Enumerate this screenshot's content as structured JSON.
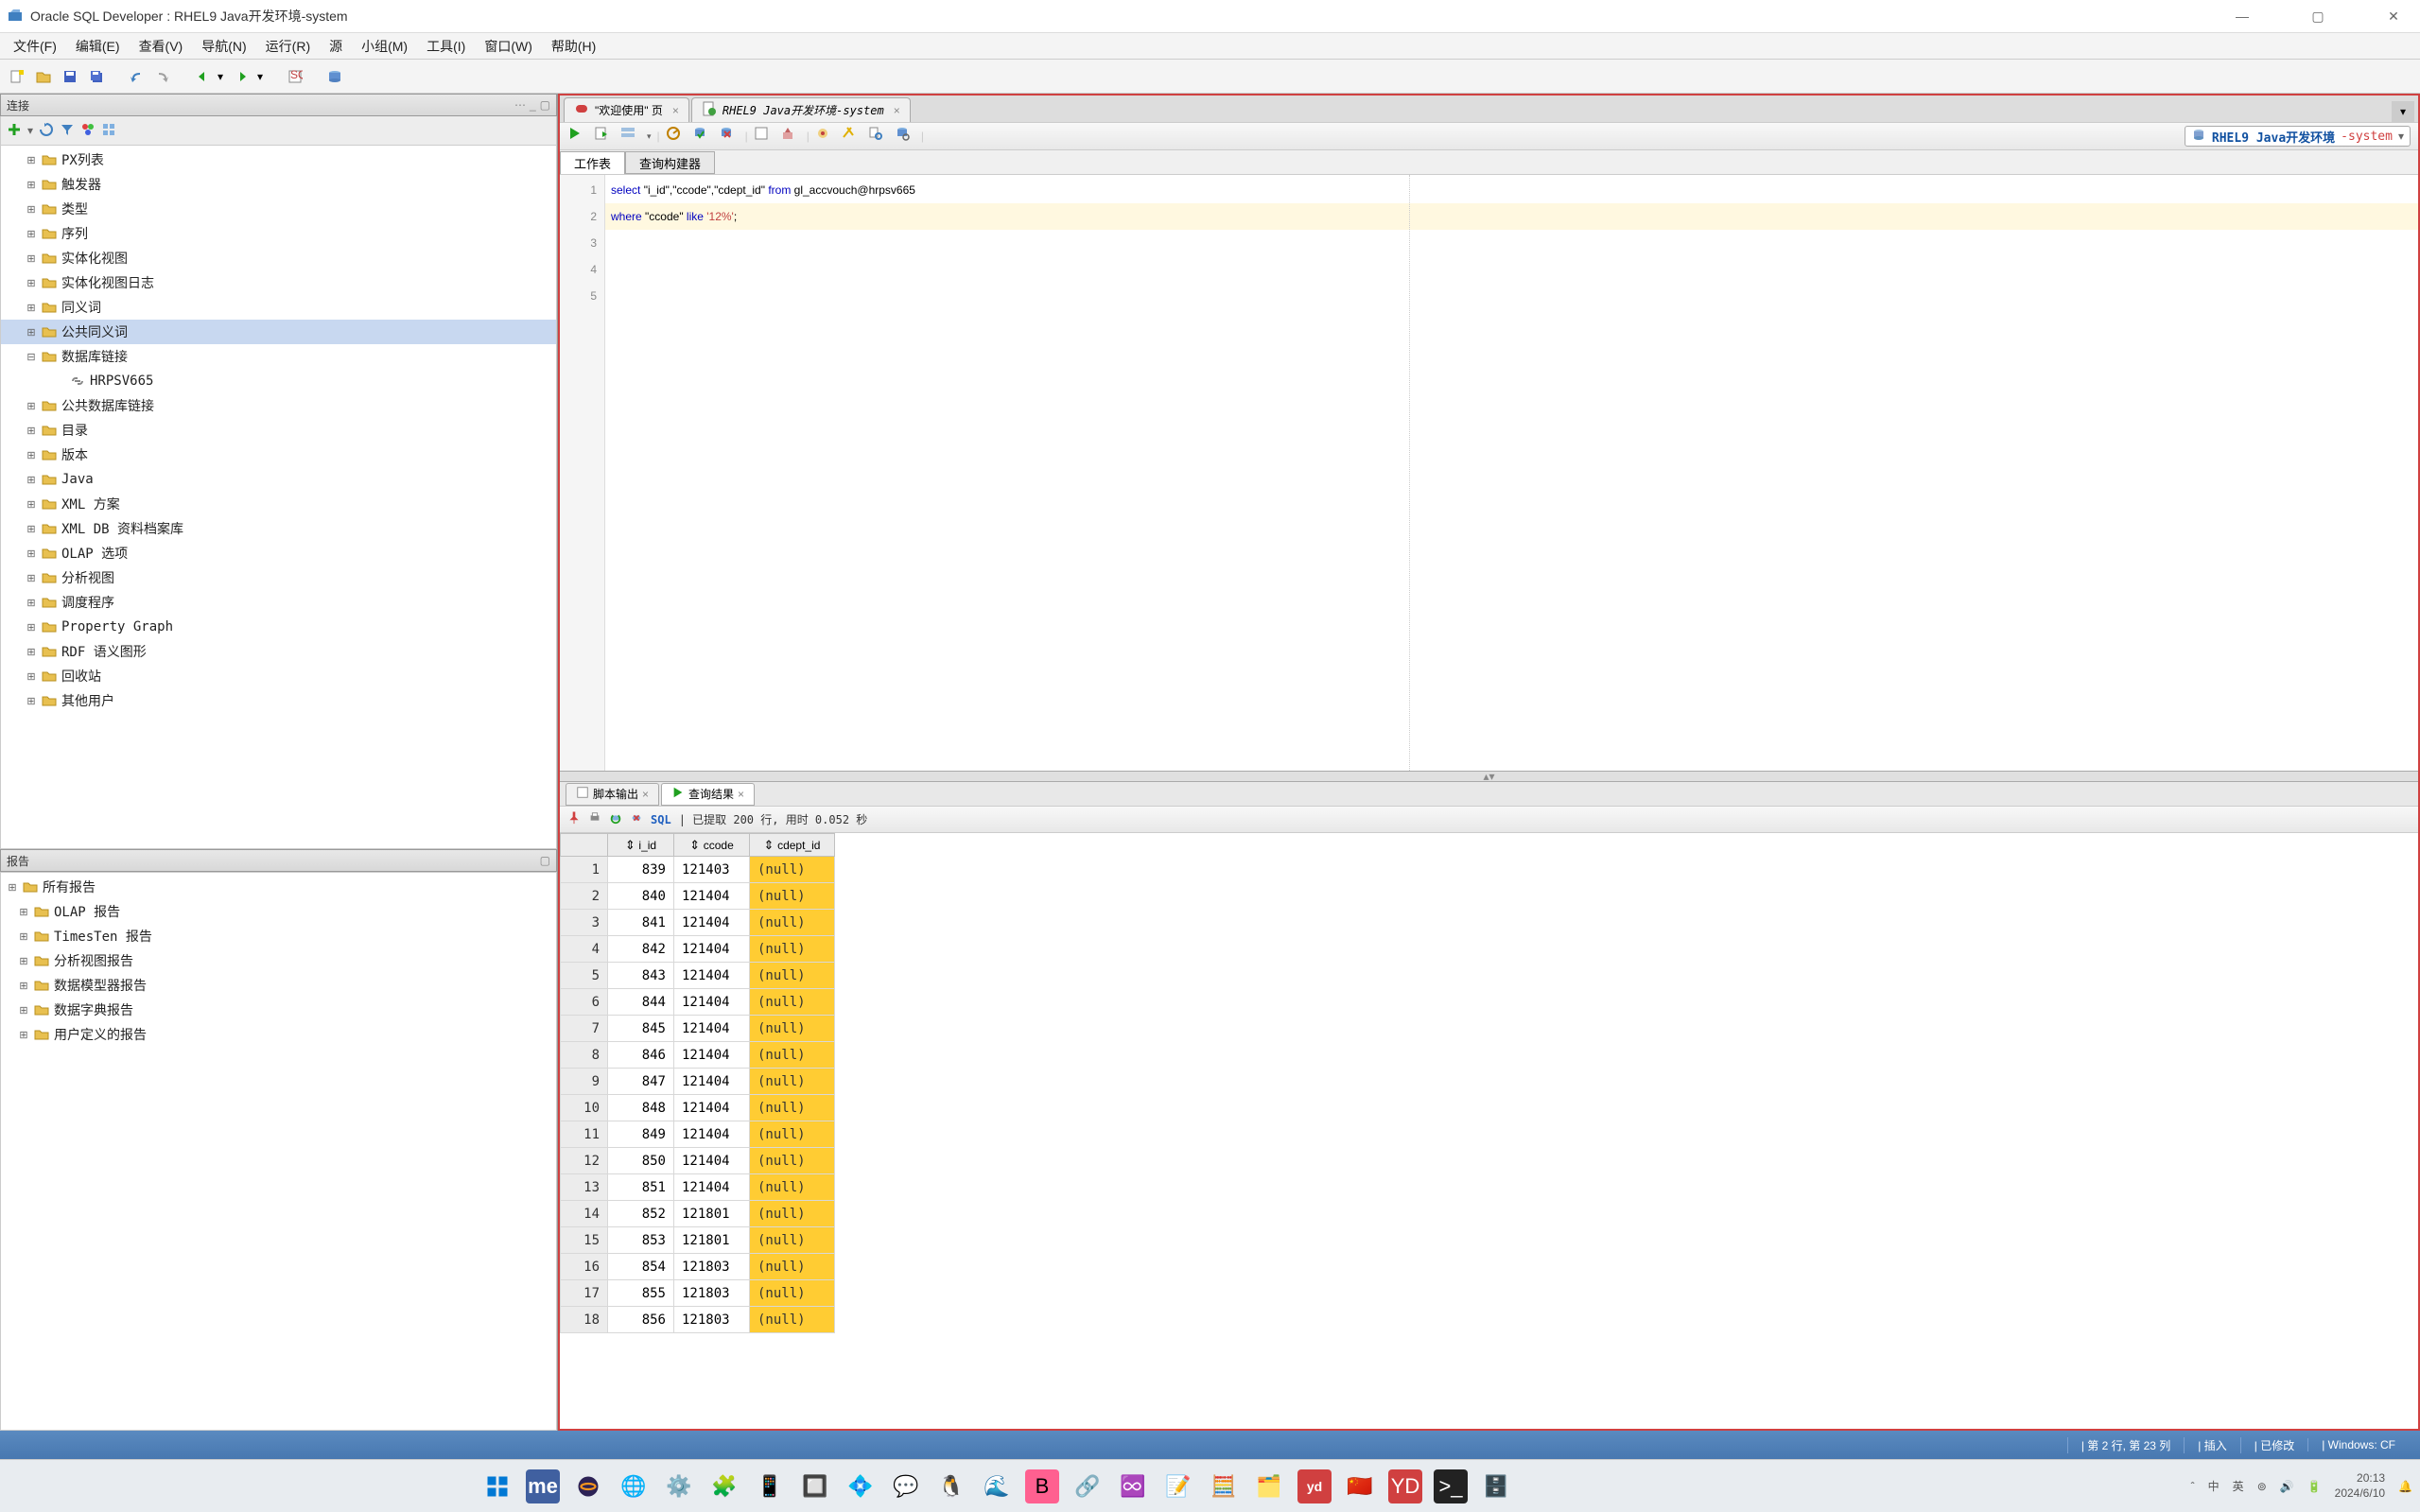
{
  "window": {
    "title": "Oracle SQL Developer : RHEL9 Java开发环境-system"
  },
  "menubar": [
    "文件(F)",
    "编辑(E)",
    "查看(V)",
    "导航(N)",
    "运行(R)",
    "源",
    "小组(M)",
    "工具(I)",
    "窗口(W)",
    "帮助(H)"
  ],
  "panels": {
    "connections_title": "连接",
    "reports_title": "报告"
  },
  "conn_tree": [
    {
      "label": "PX列表"
    },
    {
      "label": "触发器"
    },
    {
      "label": "类型"
    },
    {
      "label": "序列"
    },
    {
      "label": "实体化视图"
    },
    {
      "label": "实体化视图日志"
    },
    {
      "label": "同义词"
    },
    {
      "label": "公共同义词",
      "selected": true
    },
    {
      "label": "数据库链接",
      "expanded": true,
      "child": "HRPSV665"
    },
    {
      "label": "公共数据库链接"
    },
    {
      "label": "目录"
    },
    {
      "label": "版本"
    },
    {
      "label": "Java"
    },
    {
      "label": "XML 方案"
    },
    {
      "label": "XML DB 资料档案库"
    },
    {
      "label": "OLAP 选项"
    },
    {
      "label": "分析视图"
    },
    {
      "label": "调度程序"
    },
    {
      "label": "Property Graph"
    },
    {
      "label": "RDF 语义图形"
    },
    {
      "label": "回收站"
    },
    {
      "label": "其他用户"
    }
  ],
  "report_tree": [
    {
      "label": "所有报告"
    },
    {
      "label": "OLAP 报告"
    },
    {
      "label": "TimesTen 报告"
    },
    {
      "label": "分析视图报告"
    },
    {
      "label": "数据模型器报告"
    },
    {
      "label": "数据字典报告"
    },
    {
      "label": "用户定义的报告"
    }
  ],
  "editor_tabs": [
    {
      "label": "\"欢迎使用\" 页",
      "icon": "red"
    },
    {
      "label": "RHEL9 Java开发环境-system",
      "icon": "sql"
    }
  ],
  "connection_picker": {
    "name": "RHEL9 Java开发环境",
    "suffix": "-system"
  },
  "worksheet_tabs": {
    "active": "工作表",
    "inactive": "查询构建器"
  },
  "sql": {
    "l1_select": "select ",
    "l1_cols": "\"i_id\",\"ccode\",\"cdept_id\" ",
    "l1_from": "from ",
    "l1_tbl": "gl_accvouch@hrpsv665",
    "l2_where": "where ",
    "l2_col": "\"ccode\" ",
    "l2_like": "like ",
    "l2_str": "'12%'",
    "l2_semi": ";"
  },
  "result_tabs": {
    "script": "脚本输出",
    "query": "查询结果"
  },
  "result_status": {
    "sql_label": "SQL",
    "text": "| 已提取 200 行, 用时 0.052 秒"
  },
  "result_columns": [
    "i_id",
    "ccode",
    "cdept_id"
  ],
  "result_rows": [
    {
      "n": 1,
      "i_id": 839,
      "ccode": "121403",
      "cdept_id": "(null)"
    },
    {
      "n": 2,
      "i_id": 840,
      "ccode": "121404",
      "cdept_id": "(null)"
    },
    {
      "n": 3,
      "i_id": 841,
      "ccode": "121404",
      "cdept_id": "(null)"
    },
    {
      "n": 4,
      "i_id": 842,
      "ccode": "121404",
      "cdept_id": "(null)"
    },
    {
      "n": 5,
      "i_id": 843,
      "ccode": "121404",
      "cdept_id": "(null)"
    },
    {
      "n": 6,
      "i_id": 844,
      "ccode": "121404",
      "cdept_id": "(null)"
    },
    {
      "n": 7,
      "i_id": 845,
      "ccode": "121404",
      "cdept_id": "(null)"
    },
    {
      "n": 8,
      "i_id": 846,
      "ccode": "121404",
      "cdept_id": "(null)"
    },
    {
      "n": 9,
      "i_id": 847,
      "ccode": "121404",
      "cdept_id": "(null)"
    },
    {
      "n": 10,
      "i_id": 848,
      "ccode": "121404",
      "cdept_id": "(null)"
    },
    {
      "n": 11,
      "i_id": 849,
      "ccode": "121404",
      "cdept_id": "(null)"
    },
    {
      "n": 12,
      "i_id": 850,
      "ccode": "121404",
      "cdept_id": "(null)"
    },
    {
      "n": 13,
      "i_id": 851,
      "ccode": "121404",
      "cdept_id": "(null)"
    },
    {
      "n": 14,
      "i_id": 852,
      "ccode": "121801",
      "cdept_id": "(null)"
    },
    {
      "n": 15,
      "i_id": 853,
      "ccode": "121801",
      "cdept_id": "(null)"
    },
    {
      "n": 16,
      "i_id": 854,
      "ccode": "121803",
      "cdept_id": "(null)"
    },
    {
      "n": 17,
      "i_id": 855,
      "ccode": "121803",
      "cdept_id": "(null)"
    },
    {
      "n": 18,
      "i_id": 856,
      "ccode": "121803",
      "cdept_id": "(null)"
    }
  ],
  "statusbar": {
    "pos": "| 第 2 行, 第 23 列",
    "insert": "| 插入",
    "modified": "| 已修改",
    "platform": "| Windows: CF"
  },
  "tray": {
    "time": "20:13",
    "date": "2024/6/10",
    "lang1": "中",
    "lang2": "英"
  }
}
